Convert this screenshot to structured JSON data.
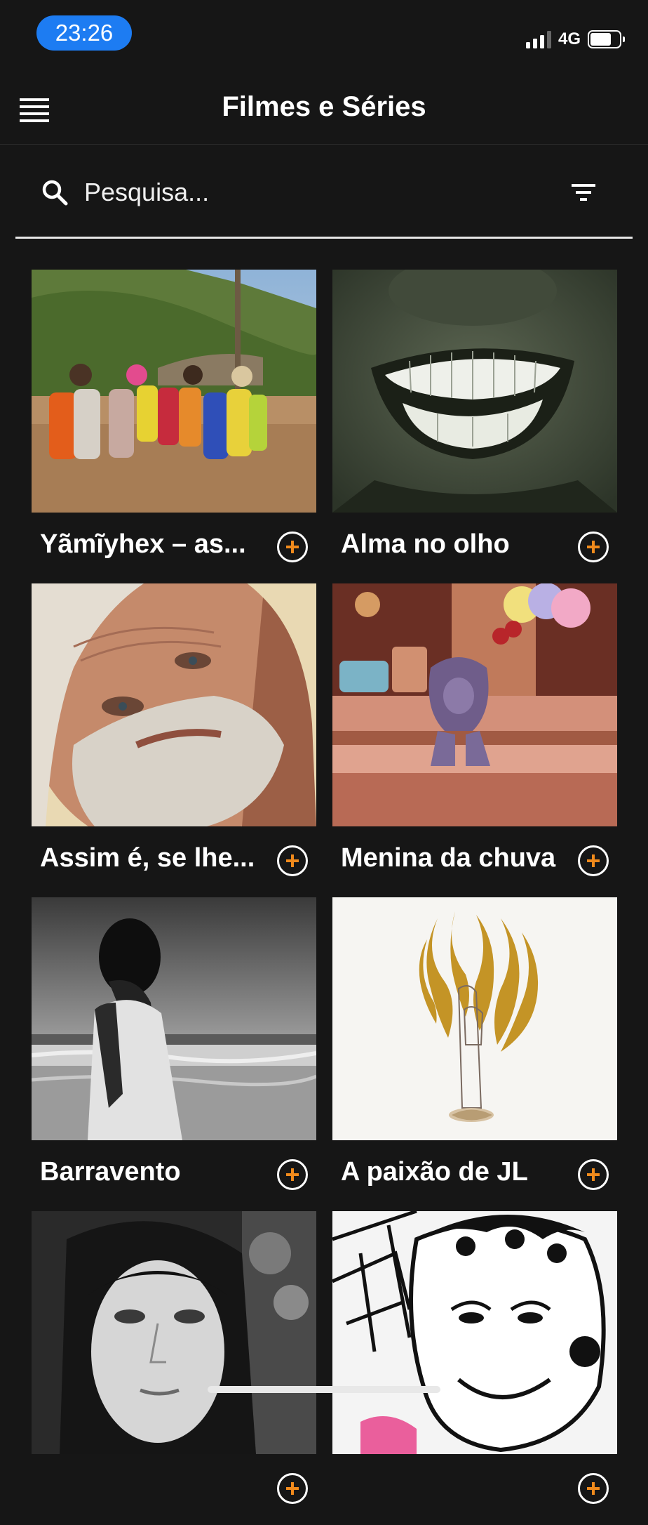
{
  "status_bar": {
    "time": "23:26",
    "network": "4G",
    "time_pill_color": "#1d7cf2",
    "battery_level": 0.72
  },
  "header": {
    "title": "Filmes e Séries",
    "menu_icon": "hamburger-menu-icon"
  },
  "search": {
    "placeholder": "Pesquisa...",
    "value": "",
    "icon": "search-icon",
    "filter_icon": "filter-icon"
  },
  "accent_color": "#f08a1c",
  "items": [
    {
      "title": "Yãmĩyhex – as...",
      "thumbnail": "dancers-circle-image"
    },
    {
      "title": "Alma no olho",
      "thumbnail": "smiling-mouth-image"
    },
    {
      "title": "Assim é, se lhe...",
      "thumbnail": "bearded-old-man-image"
    },
    {
      "title": "Menina da chuva",
      "thumbnail": "animated-girl-candy-shop-image"
    },
    {
      "title": "Barravento",
      "thumbnail": "woman-at-beach-bw-image"
    },
    {
      "title": "A paixão de JL",
      "thumbnail": "golden-flames-figure-drawing-image"
    },
    {
      "title": "",
      "thumbnail": "woman-portrait-bw-image"
    },
    {
      "title": "",
      "thumbnail": "cartoon-woman-drawing-image"
    }
  ]
}
